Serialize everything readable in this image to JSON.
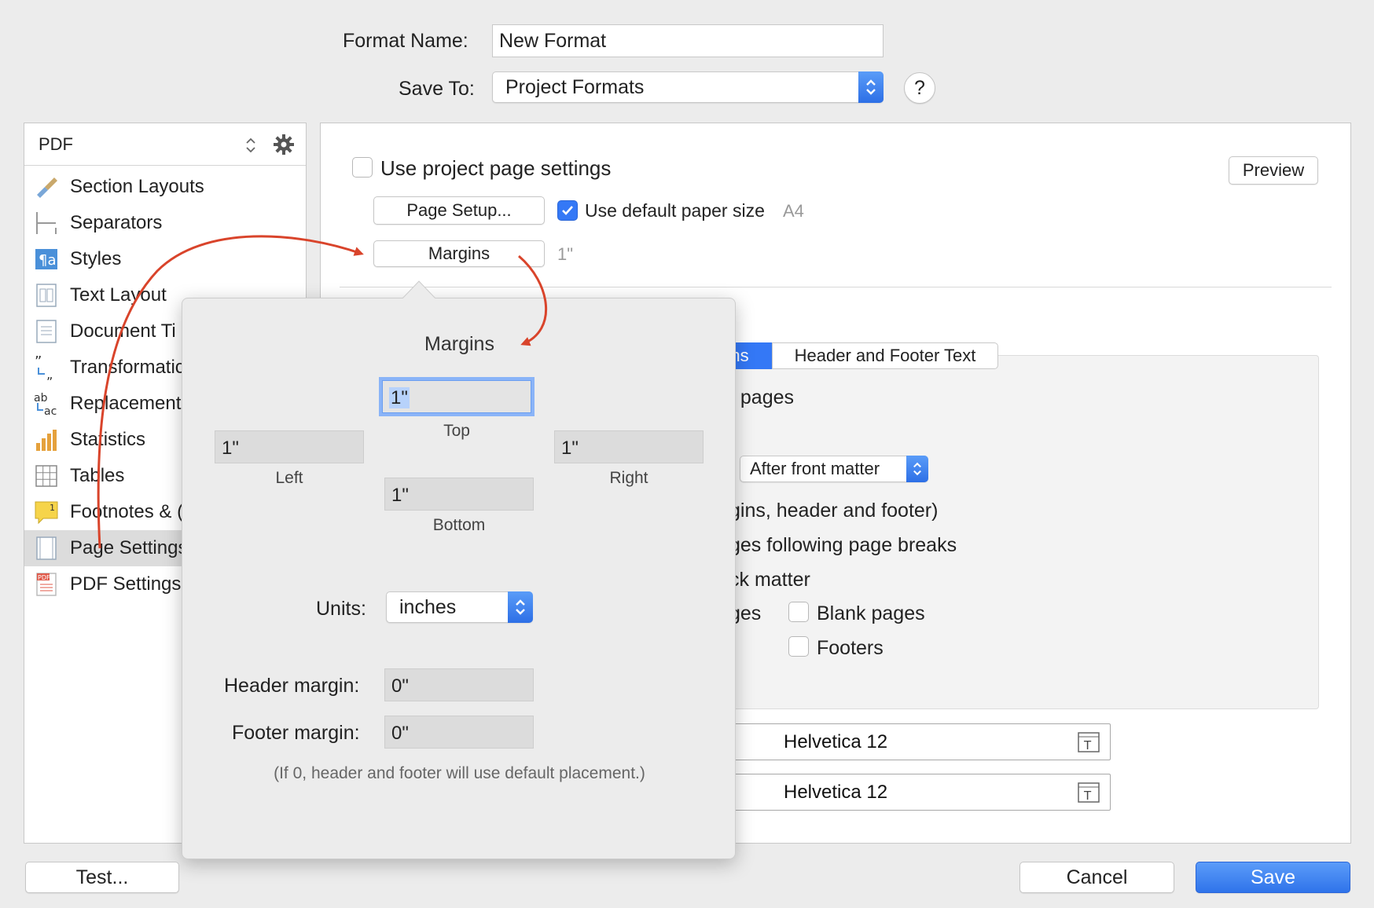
{
  "header": {
    "format_name_label": "Format Name:",
    "format_name_value": "New Format",
    "save_to_label": "Save To:",
    "save_to_value": "Project Formats",
    "help_label": "?"
  },
  "sidebar": {
    "selector": "PDF",
    "items": [
      {
        "label": "Section Layouts",
        "icon": "paintbrush-icon"
      },
      {
        "label": "Separators",
        "icon": "separators-icon"
      },
      {
        "label": "Styles",
        "icon": "styles-icon"
      },
      {
        "label": "Text Layout",
        "icon": "text-layout-icon"
      },
      {
        "label": "Document Ti",
        "icon": "document-icon"
      },
      {
        "label": "Transformatic",
        "icon": "quotes-icon"
      },
      {
        "label": "Replacement",
        "icon": "replacement-icon"
      },
      {
        "label": "Statistics",
        "icon": "bar-chart-icon"
      },
      {
        "label": "Tables",
        "icon": "table-icon"
      },
      {
        "label": "Footnotes & (",
        "icon": "footnote-icon"
      },
      {
        "label": "Page Settings",
        "icon": "page-settings-icon"
      },
      {
        "label": "PDF Settings",
        "icon": "pdf-icon"
      }
    ]
  },
  "main": {
    "use_project_settings": "Use project page settings",
    "preview": "Preview",
    "page_setup": "Page Setup...",
    "use_default_paper": "Use default paper size",
    "paper_size": "A4",
    "margins_button": "Margins",
    "margins_value": "1\"",
    "tab_partial": "ns",
    "tab_header_footer": "Header and Footer Text",
    "row_pages": "t pages",
    "dropdown_after": "After front matter",
    "row_margins": "gins, header and footer)",
    "row_breaks": "ges following page breaks",
    "row_back": "ck matter",
    "row_ges": "ges",
    "blank_pages": "Blank pages",
    "footers": "Footers",
    "font1": "Helvetica 12",
    "font2": "Helvetica 12"
  },
  "popover": {
    "title": "Margins",
    "top_value": "1\"",
    "top_label": "Top",
    "left_value": "1\"",
    "left_label": "Left",
    "right_value": "1\"",
    "right_label": "Right",
    "bottom_value": "1\"",
    "bottom_label": "Bottom",
    "units_label": "Units:",
    "units_value": "inches",
    "header_margin_label": "Header margin:",
    "header_margin_value": "0\"",
    "footer_margin_label": "Footer margin:",
    "footer_margin_value": "0\"",
    "note": "(If 0, header and footer will use default placement.)"
  },
  "footer": {
    "test": "Test...",
    "cancel": "Cancel",
    "save": "Save"
  },
  "colors": {
    "accent": "#3478f6",
    "annotation_arrow": "#d9442b"
  }
}
